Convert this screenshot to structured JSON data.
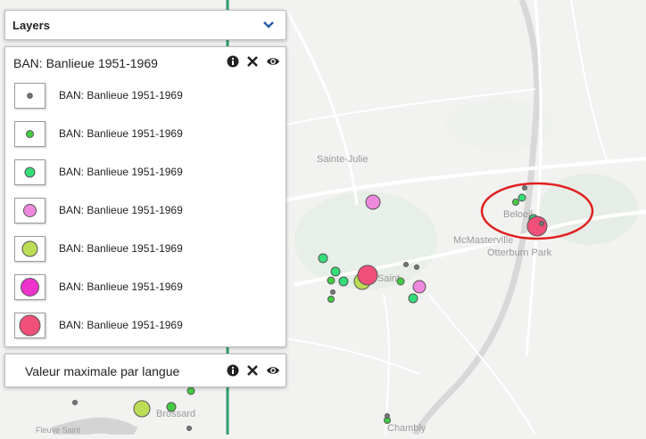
{
  "map": {
    "place_labels": [
      "Sainte-Julie",
      "Beloeil",
      "McMasterville",
      "Otterburn Park",
      "Saint",
      "Brossard",
      "Chambly",
      "Fleuve Saint"
    ],
    "colors": {
      "background": "#f2f2f1",
      "road": "#ffffff",
      "water": "#dcdcdc",
      "park": "#e7eee7",
      "transit_line": "#2e9e6a",
      "highlight_ellipse": "#e02020"
    },
    "markers": [
      {
        "color": "#33dd77",
        "size": "medium"
      },
      {
        "color": "#33dd77",
        "size": "medium"
      },
      {
        "color": "#33dd77",
        "size": "medium"
      },
      {
        "color": "#33dd77",
        "size": "medium"
      },
      {
        "color": "#33dd77",
        "size": "medium"
      },
      {
        "color": "#33dd77",
        "size": "medium"
      },
      {
        "color": "#44cc44",
        "size": "small"
      },
      {
        "color": "#44cc44",
        "size": "small"
      },
      {
        "color": "#44cc44",
        "size": "small"
      },
      {
        "color": "#44cc44",
        "size": "small"
      },
      {
        "color": "#44cc44",
        "size": "small"
      },
      {
        "color": "#44cc44",
        "size": "small"
      },
      {
        "color": "#44cc44",
        "size": "small"
      },
      {
        "color": "#777777",
        "size": "tiny"
      },
      {
        "color": "#777777",
        "size": "tiny"
      },
      {
        "color": "#777777",
        "size": "tiny"
      },
      {
        "color": "#777777",
        "size": "tiny"
      },
      {
        "color": "#777777",
        "size": "tiny"
      },
      {
        "color": "#777777",
        "size": "tiny"
      },
      {
        "color": "#777777",
        "size": "tiny"
      },
      {
        "color": "#777777",
        "size": "tiny"
      },
      {
        "color": "#ee88dd",
        "size": "large"
      },
      {
        "color": "#ee88dd",
        "size": "large"
      },
      {
        "color": "#ee88dd",
        "size": "large"
      },
      {
        "color": "#bbdd55",
        "size": "xlarge"
      },
      {
        "color": "#bbdd55",
        "size": "xlarge"
      },
      {
        "color": "#f0507a",
        "size": "xxlarge"
      },
      {
        "color": "#f0507a",
        "size": "xxlarge"
      }
    ]
  },
  "layers_panel": {
    "title": "Layers",
    "icon": "chevron-down-icon",
    "accent": "#2a5db0"
  },
  "legend": {
    "title": "BAN: Banlieue 1951-1969",
    "icons": [
      "info-icon",
      "close-icon",
      "eye-icon"
    ],
    "items": [
      {
        "label": "BAN: Banlieue 1951-1969",
        "color": "#777777",
        "size_class": "tiny"
      },
      {
        "label": "BAN: Banlieue 1951-1969",
        "color": "#44cc44",
        "size_class": "small"
      },
      {
        "label": "BAN: Banlieue 1951-1969",
        "color": "#33dd77",
        "size_class": "medium"
      },
      {
        "label": "BAN: Banlieue 1951-1969",
        "color": "#ee88dd",
        "size_class": "large"
      },
      {
        "label": "BAN: Banlieue 1951-1969",
        "color": "#bbdd55",
        "size_class": "xlarge"
      },
      {
        "label": "BAN: Banlieue 1951-1969",
        "color": "#ee33cc",
        "size_class": "xxlarge"
      },
      {
        "label": "BAN: Banlieue 1951-1969",
        "color": "#f0507a",
        "size_class": "xxxlarge"
      }
    ]
  },
  "other_layer": {
    "title": "Valeur maximale par langue",
    "icons": [
      "info-icon",
      "close-icon",
      "eye-icon"
    ]
  }
}
